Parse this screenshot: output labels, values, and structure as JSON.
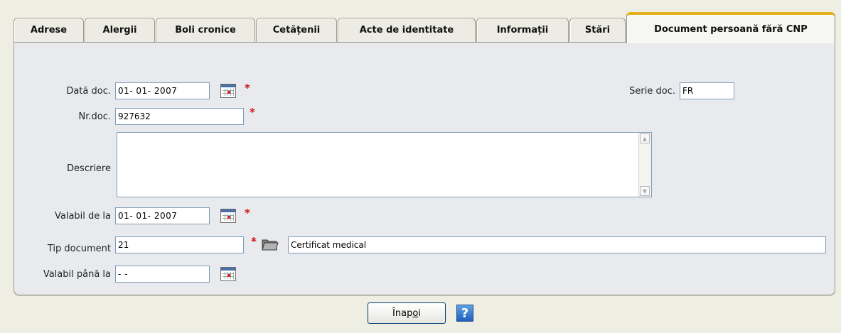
{
  "tabs": [
    {
      "label": "Adrese"
    },
    {
      "label": "Alergii"
    },
    {
      "label": "Boli cronice"
    },
    {
      "label": "Cetățenii"
    },
    {
      "label": "Acte de identitate"
    },
    {
      "label": "Informații"
    },
    {
      "label": "Stări"
    },
    {
      "label": "Document persoană fără CNP",
      "active": true
    }
  ],
  "form": {
    "data_doc": {
      "label": "Dată doc.",
      "value": "01- 01-  2007"
    },
    "serie_doc": {
      "label": "Serie doc.",
      "value": "FR"
    },
    "nr_doc": {
      "label": "Nr.doc.",
      "value": "927632"
    },
    "descriere": {
      "label": "Descriere",
      "value": ""
    },
    "valabil_de_la": {
      "label": "Valabil de la",
      "value": "01- 01-  2007"
    },
    "tip_document": {
      "label": "Tip document",
      "code": "21",
      "name": "Certificat medical"
    },
    "valabil_pana_la": {
      "label": "Valabil până la",
      "value": "  -   -"
    },
    "required_mark": "*"
  },
  "footer": {
    "back_label_pre": "Înap",
    "back_label_u": "o",
    "back_label_post": "i",
    "help_glyph": "?"
  },
  "colors": {
    "active_tab_accent": "#e3b11c",
    "required": "#cc1111",
    "panel_bg": "#e8eaee"
  },
  "icons": [
    "calendar-icon",
    "folder-icon",
    "help-icon"
  ]
}
